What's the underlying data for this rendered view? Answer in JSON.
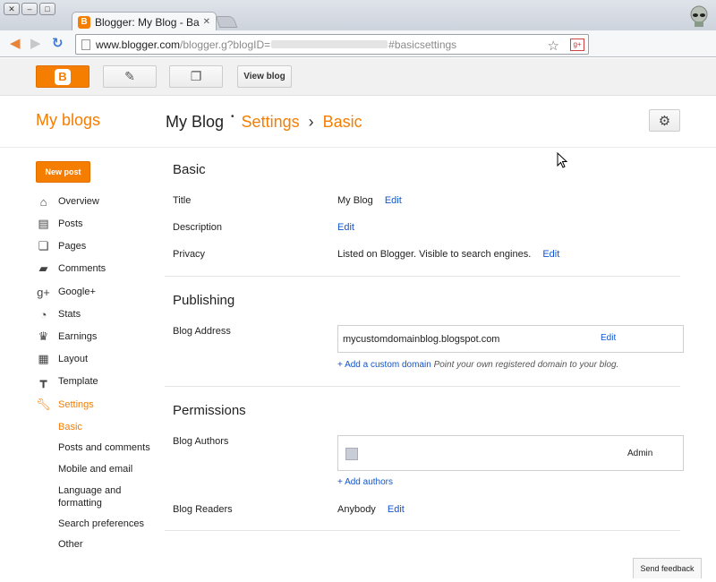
{
  "browser": {
    "tab_title": "Blogger: My Blog - Basic",
    "url_host": "www.blogger.com",
    "url_path": "/blogger.g?blogID=",
    "url_hash": "#basicsettings"
  },
  "topbar": {
    "view_blog": "View blog"
  },
  "header": {
    "my_blogs": "My blogs",
    "blog_name": "My Blog",
    "section": "Settings",
    "subsection": "Basic"
  },
  "sidebar": {
    "new_post": "New post",
    "items": [
      {
        "label": "Overview",
        "icon": "home-icon"
      },
      {
        "label": "Posts",
        "icon": "posts-icon"
      },
      {
        "label": "Pages",
        "icon": "pages-icon"
      },
      {
        "label": "Comments",
        "icon": "comment-icon"
      },
      {
        "label": "Google+",
        "icon": "google-plus-icon"
      },
      {
        "label": "Stats",
        "icon": "pie-chart-icon"
      },
      {
        "label": "Earnings",
        "icon": "trophy-icon"
      },
      {
        "label": "Layout",
        "icon": "layout-icon"
      },
      {
        "label": "Template",
        "icon": "paint-roller-icon"
      },
      {
        "label": "Settings",
        "icon": "wrench-icon"
      }
    ],
    "settings_sub": [
      "Basic",
      "Posts and comments",
      "Mobile and email",
      "Language and formatting",
      "Search preferences",
      "Other"
    ]
  },
  "basic": {
    "heading": "Basic",
    "title_label": "Title",
    "title_value": "My Blog",
    "description_label": "Description",
    "privacy_label": "Privacy",
    "privacy_value": "Listed on Blogger. Visible to search engines.",
    "edit": "Edit"
  },
  "publishing": {
    "heading": "Publishing",
    "address_label": "Blog Address",
    "address_value": "mycustomdomainblog.blogspot.com",
    "add_domain": "+ Add a custom domain",
    "add_domain_note": "Point your own registered domain to your blog."
  },
  "permissions": {
    "heading": "Permissions",
    "authors_label": "Blog Authors",
    "author_role": "Admin",
    "add_authors": "+ Add authors",
    "readers_label": "Blog Readers",
    "readers_value": "Anybody"
  },
  "footer": {
    "feedback": "Send feedback"
  },
  "colors": {
    "accent": "#f57d00",
    "link": "#1155cc"
  }
}
